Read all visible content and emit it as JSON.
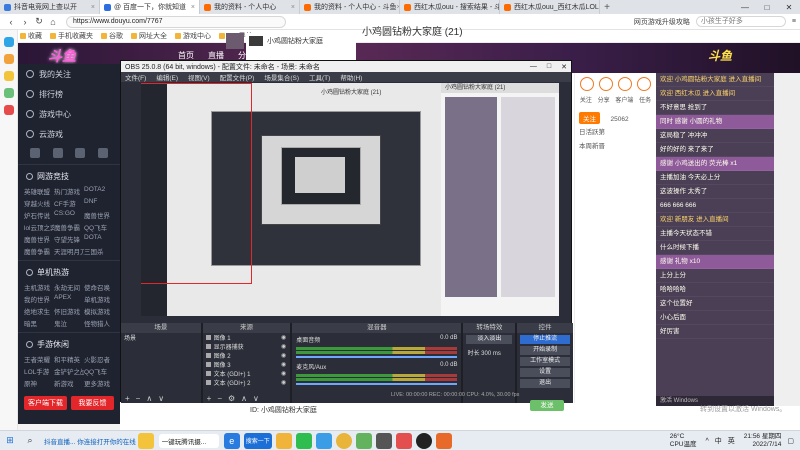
{
  "browser": {
    "tabs": [
      {
        "label": "抖音电竞网上查以开",
        "color": "#3a7be0",
        "active": false
      },
      {
        "label": "@ 百度一下，你就知道",
        "color": "#2d6fe0",
        "active": true
      },
      {
        "label": "我的资料 - 个人中心",
        "color": "#ff6a00",
        "active": false
      },
      {
        "label": "我的资料 - 个人中心 - 斗鱼",
        "color": "#ff6a00",
        "active": false
      },
      {
        "label": "西红木瓜ouu - 搜索结果 - 斗鱼",
        "color": "#ff6a00",
        "active": false
      },
      {
        "label": "西红木瓜ouu_西红木瓜LOL开始视频...",
        "color": "#ff6a00",
        "active": false
      }
    ],
    "window_buttons": [
      "—",
      "□",
      "✕"
    ],
    "url": "https://www.douyu.com/7767",
    "url_prefix": "https",
    "search_placeholder": "小孩生子好多",
    "addr_right": "网页游戏升级攻略",
    "bookmarks": [
      "收藏",
      "手机收藏夹",
      "谷歌",
      "网址大全",
      "游戏中心",
      "360导航"
    ]
  },
  "douyu": {
    "banner_logo": "斗鱼",
    "banner_right": "斗鱼",
    "nav": [
      "首页",
      "直播",
      "分类"
    ],
    "room_title": "小鸡圆钻粉大家庭 (21)",
    "mini_room": "小鸡圆钻粉大家庭",
    "sidebar": {
      "items": [
        "我的关注",
        "排行榜",
        "游戏中心",
        "云游戏"
      ],
      "section1": "网游竞技",
      "section1_grid": [
        "英雄联盟",
        "热门游戏",
        "DOTA2",
        "穿越火线",
        "CF手游",
        "DNF",
        "炉石传说",
        "CS:GO",
        "魔兽世界",
        "lol云顶之弈",
        "魔兽争霸",
        "QQ飞车",
        "魔兽世界",
        "守望先锋",
        "DOTA",
        "魔兽争霸",
        "天涯明月刀",
        "三国杀"
      ],
      "section2": "单机热游",
      "section2_grid": [
        "主机游戏",
        "永劫无间",
        "使命召唤",
        "我的世界",
        "APEX",
        "单机游戏",
        "绝地求生",
        "怀旧游戏",
        "模拟游戏",
        "暗黑",
        "鬼泣",
        "怪物猎人"
      ],
      "section3": "手游休闲",
      "section3_grid": [
        "王者荣耀",
        "和平精英",
        "火影忍者",
        "LOL手游",
        "金铲铲之战",
        "QQ飞车",
        "原神",
        "新游戏",
        "更多游戏"
      ],
      "download_btn": "客户端下载",
      "feedback_btn": "我要反馈"
    },
    "right_rail": {
      "icons": [
        "关注",
        "分享",
        "客户端",
        "任务"
      ],
      "follow_btn": "关注",
      "fans_count": "25062",
      "text1": "日活跃第",
      "text2": "本周新晋"
    },
    "chat": [
      {
        "text": "欢迎 小鸡圆钻粉大家庭 进入直播间",
        "type": "sys"
      },
      {
        "text": "欢迎 西红木瓜 进入直播间",
        "type": "sys"
      },
      {
        "text": "不好意思 抢到了",
        "type": "normal"
      },
      {
        "text": "同时 感谢 小圆的礼物",
        "type": "hl"
      },
      {
        "text": "这局稳了 冲冲冲",
        "type": "normal"
      },
      {
        "text": "好的好的 来了来了",
        "type": "normal"
      },
      {
        "text": "感谢 小鸡送出的 荧光棒 x1",
        "type": "hl"
      },
      {
        "text": "主播加油 今天必上分",
        "type": "normal"
      },
      {
        "text": "这波操作 太秀了",
        "type": "normal"
      },
      {
        "text": "666 666 666",
        "type": "normal"
      },
      {
        "text": "欢迎 新朋友 进入直播间",
        "type": "sys"
      },
      {
        "text": "主播今天状态不错",
        "type": "normal"
      },
      {
        "text": "什么时候下播",
        "type": "normal"
      },
      {
        "text": "感谢 礼物 x10",
        "type": "hl"
      },
      {
        "text": "上分上分",
        "type": "normal"
      },
      {
        "text": "哈哈哈哈",
        "type": "normal"
      },
      {
        "text": "这个位置好",
        "type": "normal"
      },
      {
        "text": "小心后面",
        "type": "normal"
      },
      {
        "text": "好厉害",
        "type": "normal"
      }
    ],
    "chat_footer": "激活 Windows",
    "below_text": "ID: 小鸡圆钻粉大家庭",
    "green_btn": "发送",
    "watermark": "转到设置以激活 Windows。"
  },
  "obs": {
    "title": "OBS 25.0.8 (64 bit, windows) - 配置文件: 未命名 - 场景: 未命名",
    "window_buttons": [
      "—",
      "□",
      "✕"
    ],
    "menu": [
      "文件(F)",
      "编辑(E)",
      "视图(V)",
      "配置文件(P)",
      "场景集合(S)",
      "工具(T)",
      "帮助(H)"
    ],
    "preview_title": "小鸡圆钻粉大家庭 (21)",
    "docks": {
      "scenes": {
        "title": "场景",
        "items": [
          "场景"
        ]
      },
      "sources": {
        "title": "来源",
        "items": [
          "图像 1",
          "显示器捕获",
          "图像 2",
          "图像 3",
          "文本 (GDI+) 1",
          "文本 (GDI+) 2"
        ]
      },
      "mixer": {
        "title": "混音器",
        "channels": [
          {
            "name": "桌面音频",
            "db": "0.0 dB"
          },
          {
            "name": "麦克风/Aux",
            "db": "0.0 dB"
          }
        ]
      },
      "transitions": {
        "title": "转场特效",
        "type": "淡入淡出",
        "duration_label": "时长",
        "duration": "300 ms"
      },
      "controls": {
        "title": "控件",
        "buttons": [
          "停止推流",
          "开始录制",
          "工作室模式",
          "设置",
          "退出"
        ]
      }
    },
    "status": "LIVE: 00:00:00   REC: 00:00:00   CPU: 4.0%, 30.00 fps"
  },
  "taskbar": {
    "search_label": "搜索一下",
    "notification": "抖音直播... 你连接打开你的在线",
    "active_app": "一键玩腾讯摄...",
    "weather_temp": "26°C",
    "weather_desc": "CPU温度",
    "tray": [
      "^",
      "中",
      "英"
    ],
    "time": "21:56",
    "weekday": "星期四",
    "date": "2022/7/14"
  }
}
